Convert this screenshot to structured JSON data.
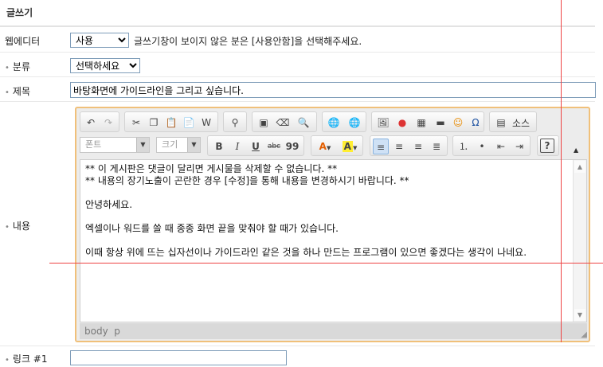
{
  "section": {
    "title": "글쓰기"
  },
  "webeditor": {
    "label": "웹에디터",
    "selected": "사용",
    "hint": "글쓰기창이 보이지 않은 분은 [사용안함]을 선택해주세요."
  },
  "category": {
    "label": "분류",
    "selected": "선택하세요"
  },
  "subject": {
    "label": "제목",
    "value": "바탕화면에 가이드라인을 그리고 싶습니다."
  },
  "content_label": "내용",
  "toolbar": {
    "source_label": "소스",
    "font_placeholder": "폰트",
    "size_placeholder": "크기",
    "bold": "B",
    "italic": "I",
    "underline": "U",
    "strike": "abc",
    "quote": "99",
    "fontcolor": "A",
    "bgcolor": "A",
    "help": "?"
  },
  "editor": {
    "paragraphs": [
      "** 이 게시판은 댓글이 달리면 게시물을 삭제할 수 없습니다. **",
      "** 내용의 장기노출이 곤란한 경우 [수정]을 통해 내용을 변경하시기 바랍니다. **",
      "",
      "안녕하세요.",
      "",
      "엑셀이나 워드를 쓸 때 종종 화면 끝을 맞춰야 할 때가 있습니다.",
      "",
      "이때 항상 위에 뜨는 십자선이나 가이드라인 같은 것을 하나 만드는 프로그램이 있으면 좋겠다는 생각이 나네요."
    ],
    "status": "body  p"
  },
  "link1": {
    "label": "링크 #1",
    "value": ""
  },
  "colors": {
    "editor_border": "#f0c07a",
    "guide_line": "#ee4444"
  }
}
